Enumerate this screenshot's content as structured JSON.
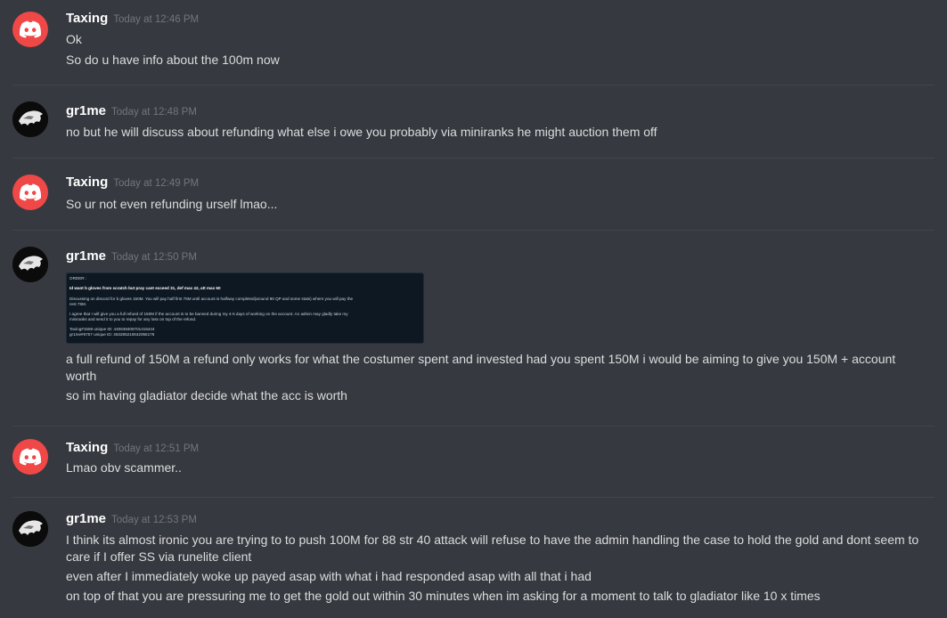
{
  "messages": [
    {
      "author": "Taxing",
      "timestamp": "Today at 12:46 PM",
      "avatar": "discord-logo-icon",
      "lines": [
        "Ok",
        "So do u have info about the 100m now"
      ]
    },
    {
      "author": "gr1me",
      "timestamp": "Today at 12:48 PM",
      "avatar": "gr1me-avatar-icon",
      "lines": [
        "no but he will discuss about refunding what else i owe you probably via miniranks he might auction them off"
      ]
    },
    {
      "author": "Taxing",
      "timestamp": "Today at 12:49 PM",
      "avatar": "discord-logo-icon",
      "lines": [
        "So ur not even refunding urself lmao..."
      ]
    },
    {
      "author": "gr1me",
      "timestamp": "Today at 12:50 PM",
      "avatar": "gr1me-avatar-icon",
      "attachment": {
        "lines": [
          "ORDER :",
          "Id want b gloves from scratch but pray cant exceed 31, def max 42, att max 60",
          "Discussing on discord for b gloves 150M. You will pay half first 75M until account is halfway completed(around 90 QP and some stats) where you will pay the",
          "rest 75M.",
          "I agree that I will give you a full refund of 150M if the account is to be banned during my 4-6 days of working on the account. An admin may gladly take my",
          "miniranks and send it to you to repay for any loss on top of the refund.",
          "Taxing#1559 unique ID: 440638406701415444",
          "gr1me#6757 unique ID: 453285210642055178"
        ]
      },
      "lines": [
        "a full refund of 150M a refund only works for what the  costumer spent and invested had you spent 150M i would be aiming to give you 150M + account worth",
        "so im having gladiator decide what the acc is worth"
      ]
    },
    {
      "author": "Taxing",
      "timestamp": "Today at 12:51 PM",
      "avatar": "discord-logo-icon",
      "lines": [
        "Lmao obv scammer.."
      ]
    },
    {
      "author": "gr1me",
      "timestamp": "Today at 12:53 PM",
      "avatar": "gr1me-avatar-icon",
      "lines": [
        "I think its almost ironic you are trying to to push 100M for 88 str 40 attack will refuse to have the admin handling the case to hold the gold and dont seem to care if I offer SS via runelite client",
        "even after I immediately woke up payed asap with what i had responded asap with all that i had",
        "on top of that you are pressuring me to get the gold out within 30 minutes when im asking for a moment to talk to gladiator like 10 x times"
      ]
    }
  ],
  "colors": {
    "background": "#36393f",
    "username": "#ffffff",
    "timestamp": "#72767d",
    "text": "#dcddde",
    "discord_avatar": "#f04747"
  }
}
